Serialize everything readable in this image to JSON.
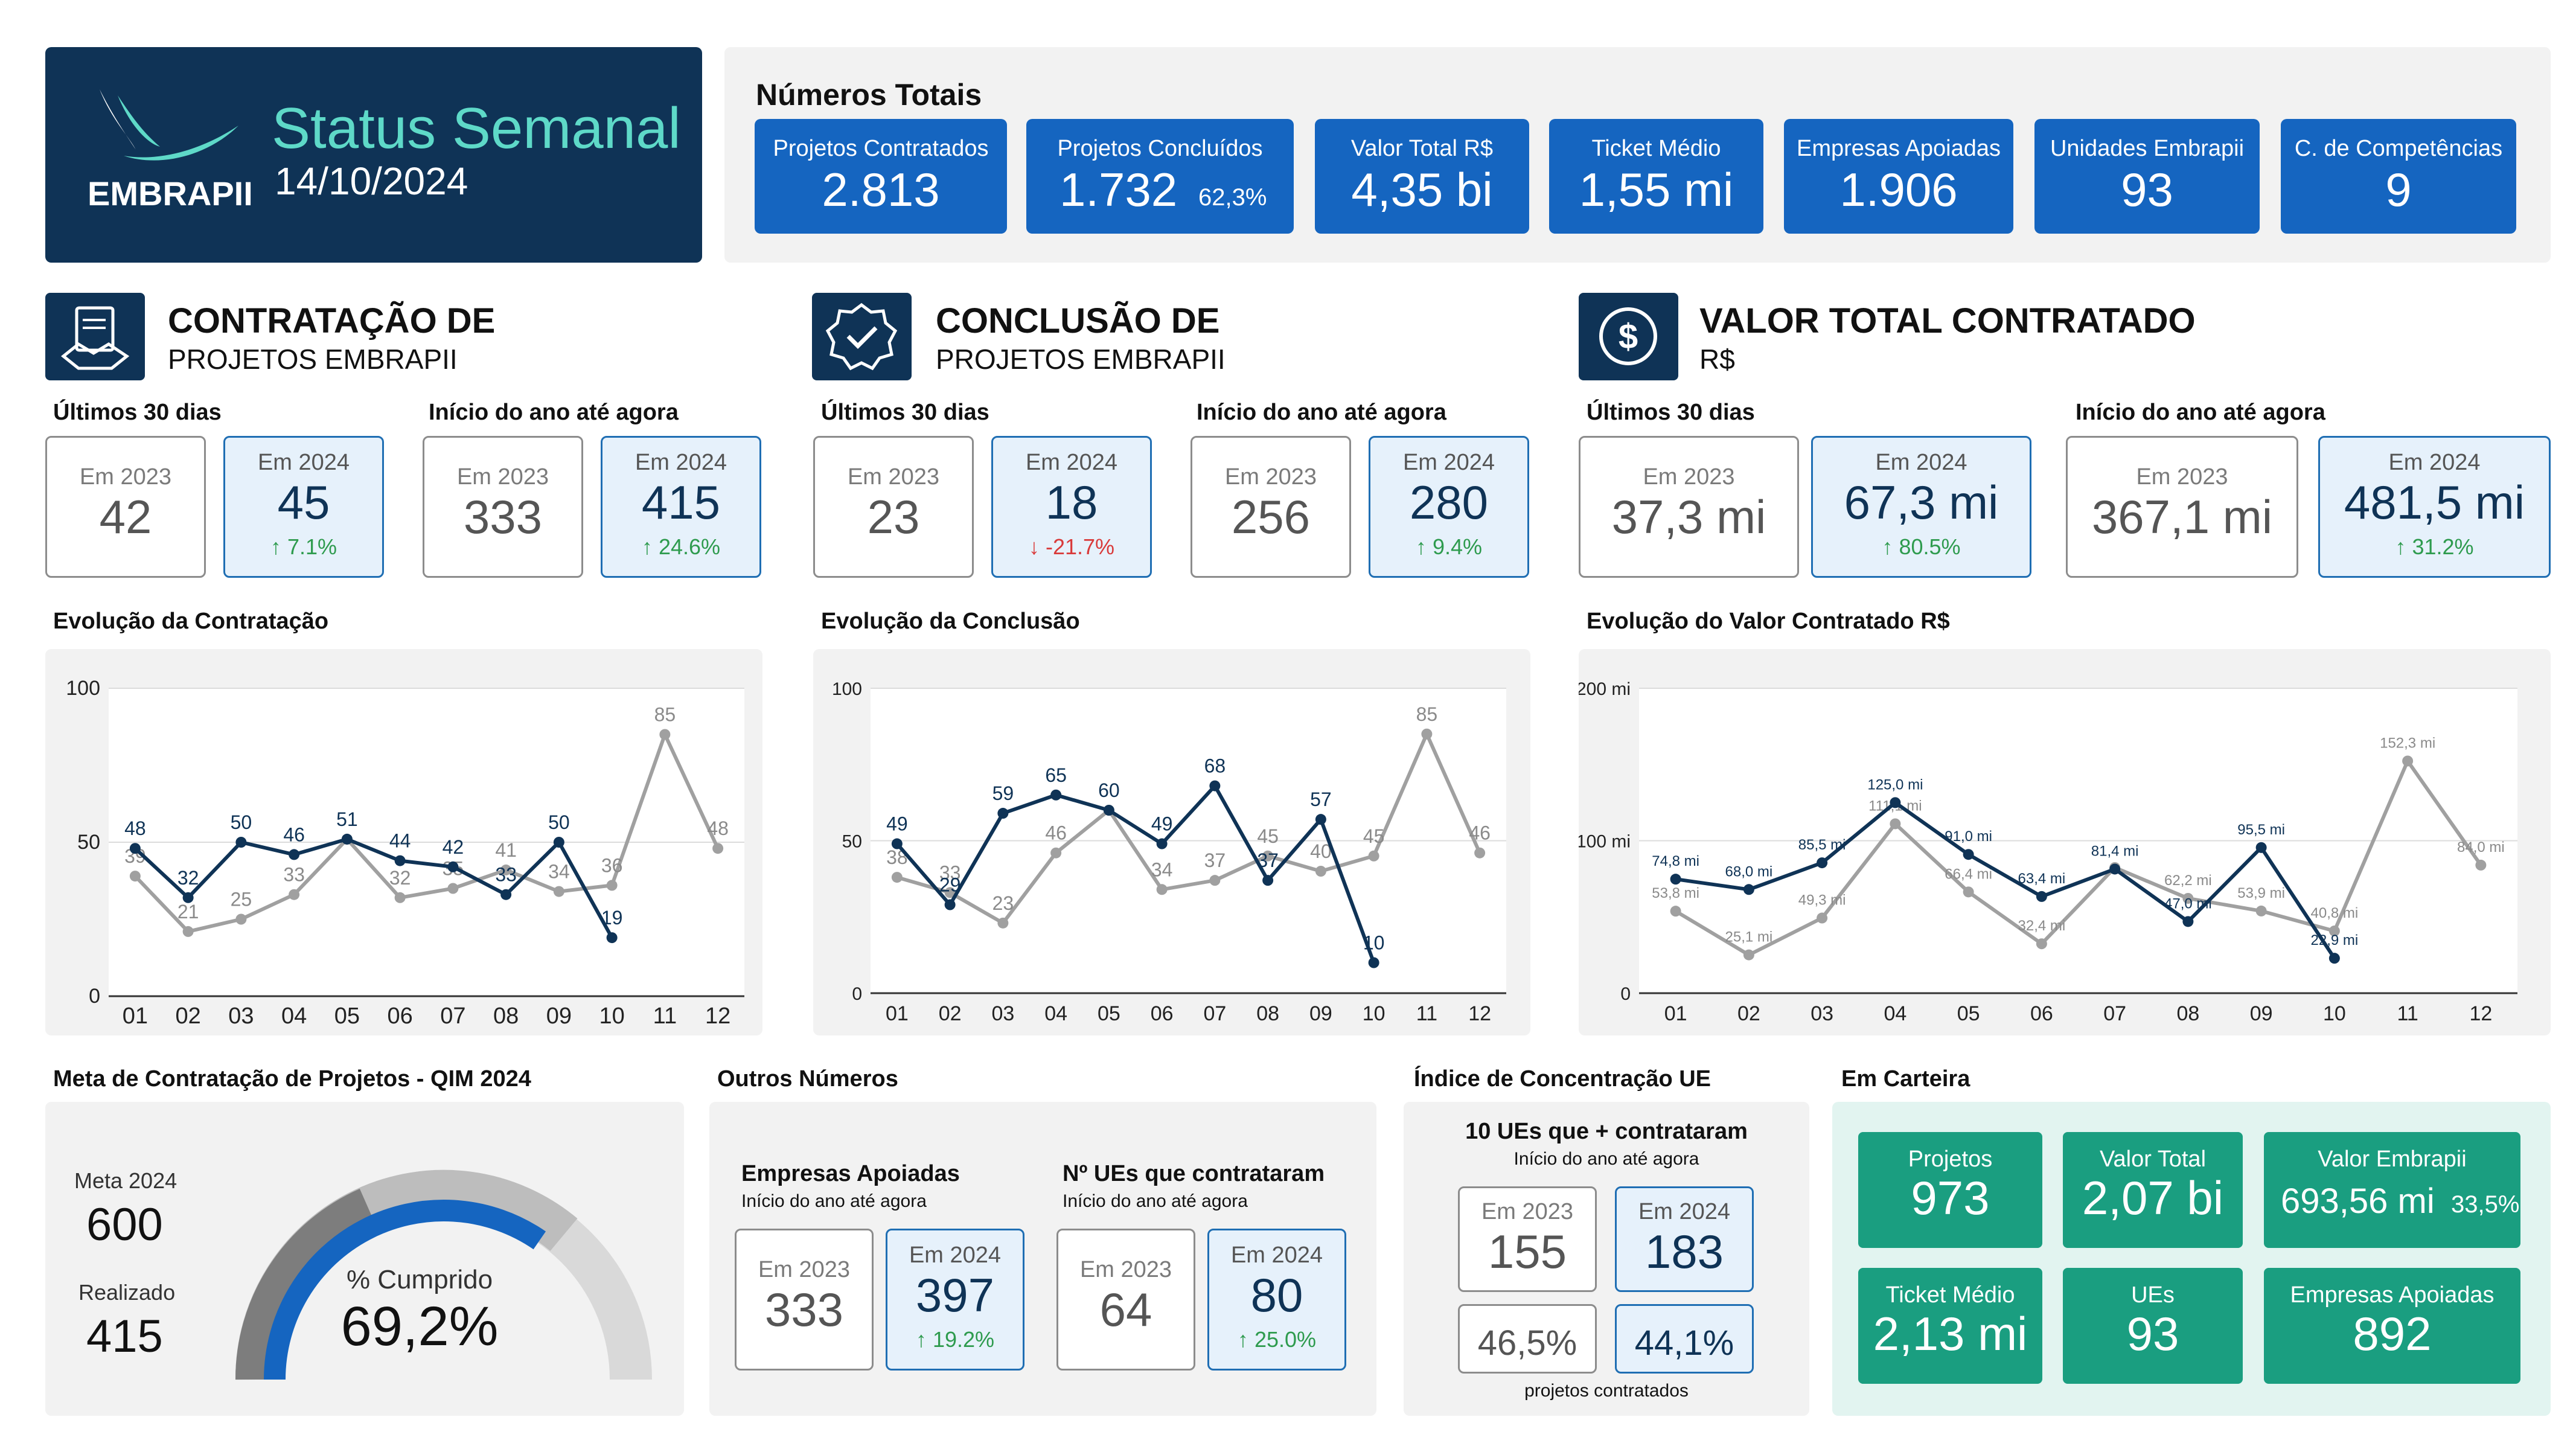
{
  "header": {
    "logo_text": "EMBRAPII",
    "title": "Status Semanal",
    "date": "14/10/2024"
  },
  "totals": {
    "title": "Números Totais",
    "cards": [
      {
        "label": "Projetos Contratados",
        "value": "2.813"
      },
      {
        "label": "Projetos Concluídos",
        "value": "1.732",
        "extra": "62,3%"
      },
      {
        "label": "Valor Total R$",
        "value": "4,35 bi"
      },
      {
        "label": "Ticket Médio",
        "value": "1,55 mi"
      },
      {
        "label": "Empresas Apoiadas",
        "value": "1.906"
      },
      {
        "label": "Unidades Embrapii",
        "value": "93"
      },
      {
        "label": "C. de Competências",
        "value": "9"
      }
    ]
  },
  "colors": {
    "navy": "#0f3356",
    "blue": "#1565c0",
    "teal": "#1a9e80",
    "gray_series": "#a0a0a0",
    "up": "#2e9b4e",
    "down": "#d93a3a"
  },
  "sections": [
    {
      "icon": "handshake-contract-icon",
      "title": "CONTRATAÇÃO DE",
      "subtitle": "PROJETOS EMBRAPII",
      "last30_label": "Últimos 30 dias",
      "ytd_label": "Início do ano até agora",
      "last30": {
        "y2023_label": "Em 2023",
        "y2023": "42",
        "y2024_label": "Em 2024",
        "y2024": "45",
        "change": "7.1%",
        "dir": "up"
      },
      "ytd": {
        "y2023_label": "Em 2023",
        "y2023": "333",
        "y2024_label": "Em 2024",
        "y2024": "415",
        "change": "24.6%",
        "dir": "up"
      },
      "chart_title": "Evolução da Contratação"
    },
    {
      "icon": "check-badge-icon",
      "title": "CONCLUSÃO DE",
      "subtitle": "PROJETOS EMBRAPII",
      "last30_label": "Últimos 30 dias",
      "ytd_label": "Início do ano até agora",
      "last30": {
        "y2023_label": "Em 2023",
        "y2023": "23",
        "y2024_label": "Em 2024",
        "y2024": "18",
        "change": "-21.7%",
        "dir": "down"
      },
      "ytd": {
        "y2023_label": "Em 2023",
        "y2023": "256",
        "y2024_label": "Em 2024",
        "y2024": "280",
        "change": "9.4%",
        "dir": "up"
      },
      "chart_title": "Evolução da Conclusão"
    },
    {
      "icon": "dollar-coin-icon",
      "title": "VALOR TOTAL CONTRATADO",
      "subtitle": "R$",
      "last30_label": "Últimos 30 dias",
      "ytd_label": "Início do ano até agora",
      "last30": {
        "y2023_label": "Em 2023",
        "y2023": "37,3 mi",
        "y2024_label": "Em 2024",
        "y2024": "67,3 mi",
        "change": "80.5%",
        "dir": "up"
      },
      "ytd": {
        "y2023_label": "Em 2023",
        "y2023": "367,1 mi",
        "y2024_label": "Em 2024",
        "y2024": "481,5 mi",
        "change": "31.2%",
        "dir": "up"
      },
      "chart_title": "Evolução do Valor Contratado R$"
    }
  ],
  "chart_data": [
    {
      "type": "line",
      "x": [
        "01",
        "02",
        "03",
        "04",
        "05",
        "06",
        "07",
        "08",
        "09",
        "10",
        "11",
        "12"
      ],
      "ylim": [
        0,
        100
      ],
      "yticks": [
        "0",
        "50",
        "100"
      ],
      "series": [
        {
          "color": "#a0a0a0",
          "values": [
            39,
            21,
            25,
            33,
            51,
            32,
            35,
            41,
            34,
            36,
            85,
            48
          ],
          "labels": [
            "39",
            "21",
            "25",
            "33",
            "",
            "32",
            "35",
            "41",
            "34",
            "36",
            "85",
            "48"
          ]
        },
        {
          "color": "#0f3356",
          "values": [
            48,
            32,
            50,
            46,
            51,
            44,
            42,
            33,
            50,
            19,
            null,
            null
          ],
          "labels": [
            "48",
            "32",
            "50",
            "46",
            "51",
            "44",
            "42",
            "33",
            "50",
            "19",
            "",
            ""
          ]
        }
      ]
    },
    {
      "type": "line",
      "x": [
        "01",
        "02",
        "03",
        "04",
        "05",
        "06",
        "07",
        "08",
        "09",
        "10",
        "11",
        "12"
      ],
      "ylim": [
        0,
        100
      ],
      "yticks": [
        "0",
        "50",
        "100"
      ],
      "series": [
        {
          "color": "#a0a0a0",
          "values": [
            38,
            33,
            23,
            46,
            60,
            34,
            37,
            45,
            40,
            45,
            85,
            46
          ],
          "labels": [
            "38",
            "33",
            "23",
            "46",
            "",
            "34",
            "37",
            "45",
            "40",
            "45",
            "85",
            "46"
          ]
        },
        {
          "color": "#0f3356",
          "values": [
            49,
            29,
            59,
            65,
            60,
            49,
            68,
            37,
            57,
            10,
            null,
            null
          ],
          "labels": [
            "49",
            "29",
            "59",
            "65",
            "60",
            "49",
            "68",
            "37",
            "57",
            "10",
            "",
            ""
          ]
        }
      ]
    },
    {
      "type": "line",
      "x": [
        "01",
        "02",
        "03",
        "04",
        "05",
        "06",
        "07",
        "08",
        "09",
        "10",
        "11",
        "12"
      ],
      "ylim": [
        0,
        200
      ],
      "yticks": [
        "0",
        "100 mi",
        "200 mi"
      ],
      "series": [
        {
          "color": "#a0a0a0",
          "values": [
            53.8,
            25.1,
            49.3,
            111.1,
            66.4,
            32.4,
            82.4,
            62.2,
            53.9,
            40.8,
            152.3,
            84.0
          ],
          "labels": [
            "53,8 mi",
            "25,1 mi",
            "49,3 mi",
            "111,1 mi",
            "66,4 mi",
            "32,4 mi",
            "",
            "62,2 mi",
            "53,9 mi",
            "40,8 mi",
            "152,3 mi",
            "84,0 mi"
          ]
        },
        {
          "color": "#0f3356",
          "values": [
            74.8,
            68.0,
            85.5,
            125.0,
            91.0,
            63.4,
            81.4,
            47.0,
            95.5,
            22.9,
            null,
            null
          ],
          "labels": [
            "74,8 mi",
            "68,0 mi",
            "85,5 mi",
            "125,0 mi",
            "91,0 mi",
            "63,4 mi",
            "81,4 mi",
            "47,0 mi",
            "95,5 mi",
            "22,9 mi",
            "",
            ""
          ]
        }
      ]
    }
  ],
  "meta": {
    "title": "Meta de Contratação de Projetos - QIM 2024",
    "meta_label": "Meta 2024",
    "meta_value": "600",
    "real_label": "Realizado",
    "real_value": "415",
    "pct_label": "% Cumprido",
    "pct_value": "69,2%",
    "fraction": 0.692
  },
  "outros": {
    "title": "Outros Números",
    "empresas": {
      "title": "Empresas Apoiadas",
      "sub": "Início do ano até agora",
      "y2023_label": "Em 2023",
      "y2023": "333",
      "y2024_label": "Em 2024",
      "y2024": "397",
      "change": "19.2%"
    },
    "ues": {
      "title": "Nº UEs que contrataram",
      "sub": "Início do ano até agora",
      "y2023_label": "Em 2023",
      "y2023": "64",
      "y2024_label": "Em 2024",
      "y2024": "80",
      "change": "25.0%"
    }
  },
  "indice": {
    "title": "Índice de Concentração UE",
    "heading": "10 UEs que + contrataram",
    "sub": "Início do ano até agora",
    "y2023_label": "Em 2023",
    "y2023": "155",
    "y2024_label": "Em 2024",
    "y2024": "183",
    "pct2023": "46,5%",
    "pct2024": "44,1%",
    "footer": "projetos contratados"
  },
  "carteira": {
    "title": "Em Carteira",
    "cards": [
      {
        "label": "Projetos",
        "value": "973"
      },
      {
        "label": "Valor Total",
        "value": "2,07 bi"
      },
      {
        "label": "Valor Embrapii",
        "value": "693,56 mi",
        "extra": "33,5%"
      },
      {
        "label": "Ticket Médio",
        "value": "2,13 mi"
      },
      {
        "label": "UEs",
        "value": "93"
      },
      {
        "label": "Empresas Apoiadas",
        "value": "892"
      }
    ]
  }
}
